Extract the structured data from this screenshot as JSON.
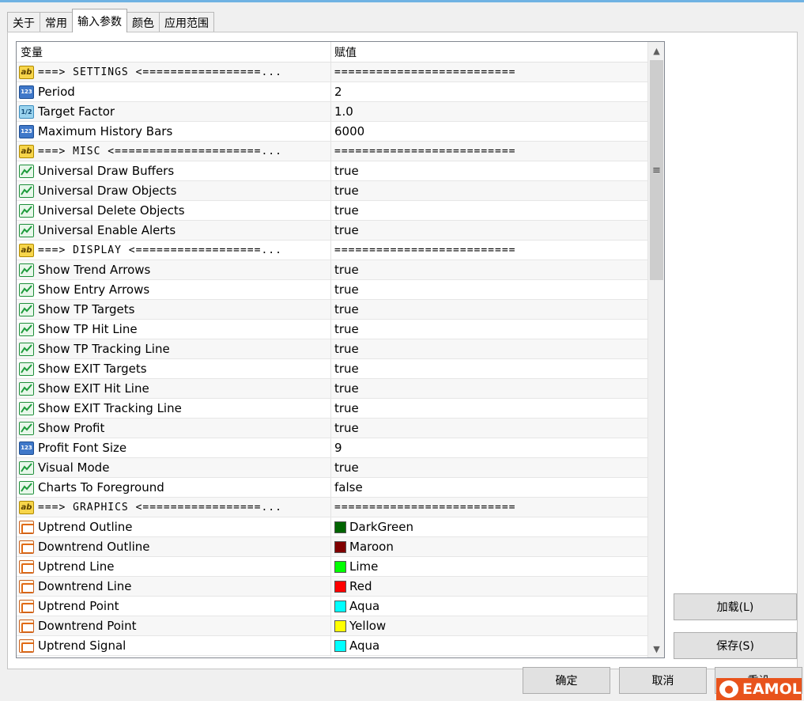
{
  "tabs": [
    {
      "label": "关于",
      "active": false
    },
    {
      "label": "常用",
      "active": false
    },
    {
      "label": "输入参数",
      "active": true
    },
    {
      "label": "颜色",
      "active": false
    },
    {
      "label": "应用范围",
      "active": false
    }
  ],
  "grid": {
    "columns": [
      "变量",
      "赋值"
    ],
    "rows": [
      {
        "type": "str",
        "name": "===> SETTINGS <=================...",
        "value": "==========================",
        "sep": true
      },
      {
        "type": "int",
        "name": "Period",
        "value": "2"
      },
      {
        "type": "dbl",
        "name": "Target Factor",
        "value": "1.0"
      },
      {
        "type": "int",
        "name": "Maximum History Bars",
        "value": "6000"
      },
      {
        "type": "str",
        "name": "===> MISC <=====================...",
        "value": "==========================",
        "sep": true
      },
      {
        "type": "bool",
        "name": "Universal Draw Buffers",
        "value": "true"
      },
      {
        "type": "bool",
        "name": "Universal Draw Objects",
        "value": "true"
      },
      {
        "type": "bool",
        "name": "Universal Delete Objects",
        "value": "true"
      },
      {
        "type": "bool",
        "name": "Universal Enable Alerts",
        "value": "true"
      },
      {
        "type": "str",
        "name": "===> DISPLAY <==================...",
        "value": "==========================",
        "sep": true
      },
      {
        "type": "bool",
        "name": "Show Trend Arrows",
        "value": "true"
      },
      {
        "type": "bool",
        "name": "Show Entry Arrows",
        "value": "true"
      },
      {
        "type": "bool",
        "name": "Show TP Targets",
        "value": "true"
      },
      {
        "type": "bool",
        "name": "Show TP Hit Line",
        "value": "true"
      },
      {
        "type": "bool",
        "name": "Show TP Tracking Line",
        "value": "true"
      },
      {
        "type": "bool",
        "name": "Show EXIT Targets",
        "value": "true"
      },
      {
        "type": "bool",
        "name": "Show EXIT Hit Line",
        "value": "true"
      },
      {
        "type": "bool",
        "name": "Show EXIT Tracking Line",
        "value": "true"
      },
      {
        "type": "bool",
        "name": "Show Profit",
        "value": "true"
      },
      {
        "type": "int",
        "name": "Profit Font Size",
        "value": "9"
      },
      {
        "type": "bool",
        "name": "Visual Mode",
        "value": "true"
      },
      {
        "type": "bool",
        "name": "Charts To Foreground",
        "value": "false"
      },
      {
        "type": "str",
        "name": "===> GRAPHICS <=================...",
        "value": "==========================",
        "sep": true
      },
      {
        "type": "color",
        "name": "Uptrend Outline",
        "value": "DarkGreen",
        "swatch": "#006400"
      },
      {
        "type": "color",
        "name": "Downtrend Outline",
        "value": "Maroon",
        "swatch": "#800000"
      },
      {
        "type": "color",
        "name": "Uptrend Line",
        "value": "Lime",
        "swatch": "#00ff00"
      },
      {
        "type": "color",
        "name": "Downtrend Line",
        "value": "Red",
        "swatch": "#ff0000"
      },
      {
        "type": "color",
        "name": "Uptrend Point",
        "value": "Aqua",
        "swatch": "#00ffff"
      },
      {
        "type": "color",
        "name": "Downtrend Point",
        "value": "Yellow",
        "swatch": "#ffff00"
      },
      {
        "type": "color",
        "name": "Uptrend Signal",
        "value": "Aqua",
        "swatch": "#00ffff"
      }
    ]
  },
  "icons": {
    "str": "ab",
    "int": "123",
    "dbl": "1/2"
  },
  "side_buttons": {
    "load": "加载(L)",
    "save": "保存(S)"
  },
  "bottom_buttons": {
    "ok": "确定",
    "cancel": "取消",
    "reset": "重设"
  },
  "watermark": {
    "text": "EAMOL"
  }
}
